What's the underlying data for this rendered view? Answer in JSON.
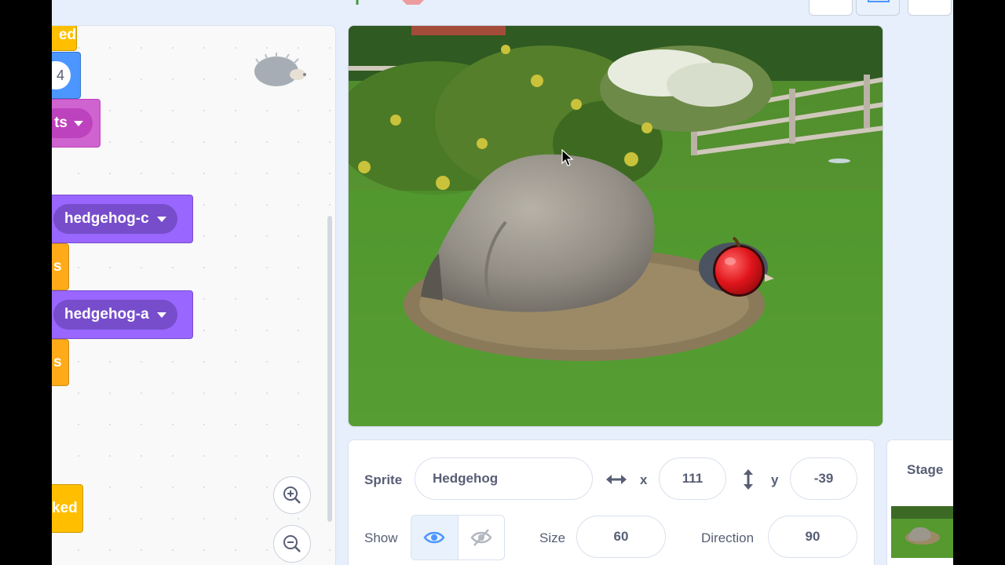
{
  "palette_blocks": {
    "events_top_text": "ed",
    "motion_value": "4",
    "looks_pink_dd": "ts",
    "switch_costume_1": "hedgehog-c",
    "control_1_text": "s",
    "switch_costume_2": "hedgehog-a",
    "control_2_text": "s",
    "events_bottom_text": "ked"
  },
  "sprite_info": {
    "sprite_label": "Sprite",
    "sprite_name": "Hedgehog",
    "x_label": "x",
    "x_value": "111",
    "y_label": "y",
    "y_value": "-39",
    "show_label": "Show",
    "show_visible": true,
    "size_label": "Size",
    "size_value": "60",
    "direction_label": "Direction",
    "direction_value": "90"
  },
  "stage_panel": {
    "title": "Stage"
  },
  "icons": [
    "green-flag-icon",
    "stop-icon",
    "small-stage-icon",
    "normal-stage-icon",
    "fullscreen-icon",
    "zoom-in-icon",
    "zoom-out-icon",
    "eye-icon",
    "eye-slash-icon",
    "horizontal-arrows-icon",
    "vertical-arrows-icon",
    "mouse-cursor-icon"
  ],
  "colors": {
    "events": "#ffbf00",
    "control": "#ffab19",
    "motion": "#4c97ff",
    "looks": "#9966ff",
    "looks_pink": "#cf63cf",
    "accent": "#4c97ff"
  }
}
